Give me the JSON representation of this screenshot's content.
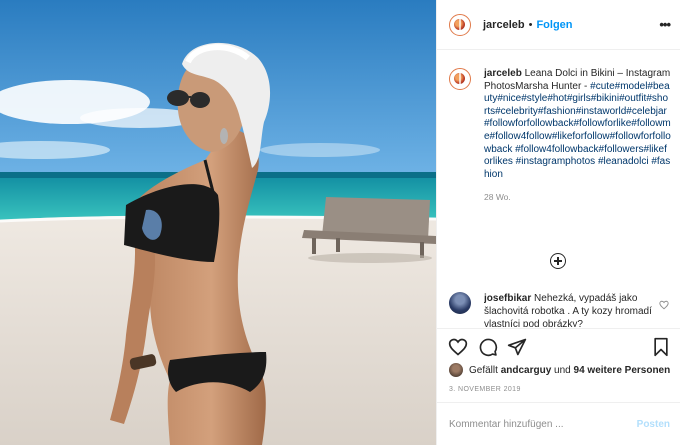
{
  "post": {
    "author": {
      "username": "jarceleb",
      "separator": "•",
      "follow_label": "Folgen",
      "more_icon": "more-horizontal-icon"
    },
    "caption": {
      "username": "jarceleb",
      "text": "Leana Dolci in Bikini – Instagram PhotosMarsha Hunter -",
      "hashtags": "#cute#model#beauty#nice#style#hot#girls#bikini#outfit#shorts#celebrity#fashion#instaworld#celebjar#followforfollowback#followforlike#followme#follow4follow#likeforfollow#followforfollowback #follow4followback#followers#likeforlikes #instagramphotos #leanadolci #fashion",
      "time_ago": "28 Wo."
    },
    "load_more_icon": "plus-circle-icon",
    "comments": [
      {
        "username": "josefbikar",
        "text": "Nehezká, vypadáš jako šlachovitá robotka . A ty kozy hromadí vlastníci pod obrázky?"
      }
    ],
    "actions": {
      "like_icon": "heart-icon",
      "comment_icon": "comment-icon",
      "share_icon": "paper-plane-icon",
      "save_icon": "bookmark-icon"
    },
    "likes": {
      "prefix": "Gefällt",
      "liker": "andcarguy",
      "connector": "und",
      "others": "94 weitere Personen"
    },
    "date": "3. NOVEMBER 2019",
    "add_comment": {
      "placeholder": "Kommentar hinzufügen ...",
      "post_label": "Posten"
    }
  },
  "colors": {
    "accent_blue": "#0095f6",
    "hashtag_blue": "#00376b",
    "muted": "#8e8e8e",
    "post_disabled": "#b2dffc"
  }
}
